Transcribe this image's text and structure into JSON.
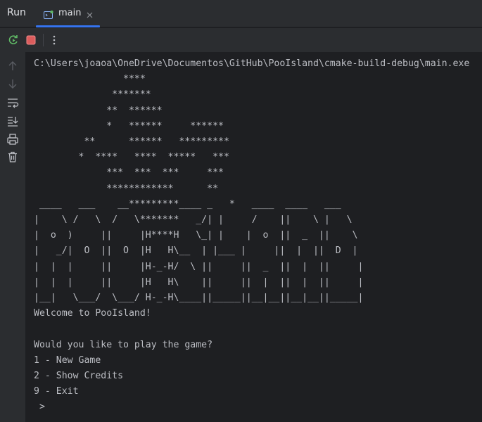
{
  "header": {
    "tool_window_title": "Run",
    "tab": {
      "label": "main"
    }
  },
  "toolbar": {
    "rerun": "rerun-icon",
    "stop": "stop-icon",
    "more": "more-vertical-icon"
  },
  "gutter": {
    "icons": [
      "arrow-up-icon",
      "arrow-down-icon",
      "soft-wrap-icon",
      "scroll-to-end-icon",
      "print-icon",
      "trash-icon"
    ]
  },
  "console": {
    "lines": [
      "C:\\Users\\joaoa\\OneDrive\\Documentos\\GitHub\\PooIsland\\cmake-build-debug\\main.exe",
      "                ****",
      "              *******",
      "             **  ******",
      "             *   ******     ******",
      "         **      ******   *********",
      "        *  ****   ****  *****   ***",
      "             ***  ***  ***     ***",
      "             ************      **",
      " ____   ___    __*********____ _   *   ____  ____   ___",
      "|    \\ /   \\  /   \\*******   _/| |     /    ||    \\ |   \\",
      "|  o  )     ||     |H****H   \\_| |    |  o  ||  _  ||    \\",
      "|   _/|  O  ||  O  |H   H\\__  | |___ |     ||  |  ||  D  |",
      "|  |  |     ||     |H-_-H/  \\ ||     ||  _  ||  |  ||     |",
      "|  |  |     ||     |H   H\\    ||     ||  |  ||  |  ||     |",
      "|__|   \\___/  \\___/ H-_-H\\____||_____||__|__||__|__||_____|",
      "Welcome to PooIsland!",
      "",
      "Would you like to play the game?",
      "1 - New Game",
      "2 - Show Credits",
      "9 - Exit",
      " >"
    ]
  },
  "colors": {
    "background": "#1e1f22",
    "panel": "#2b2d30",
    "text": "#bcbec4",
    "accent": "#3574f0",
    "run_green": "#5fb865",
    "stop_red": "#db5c5c"
  }
}
